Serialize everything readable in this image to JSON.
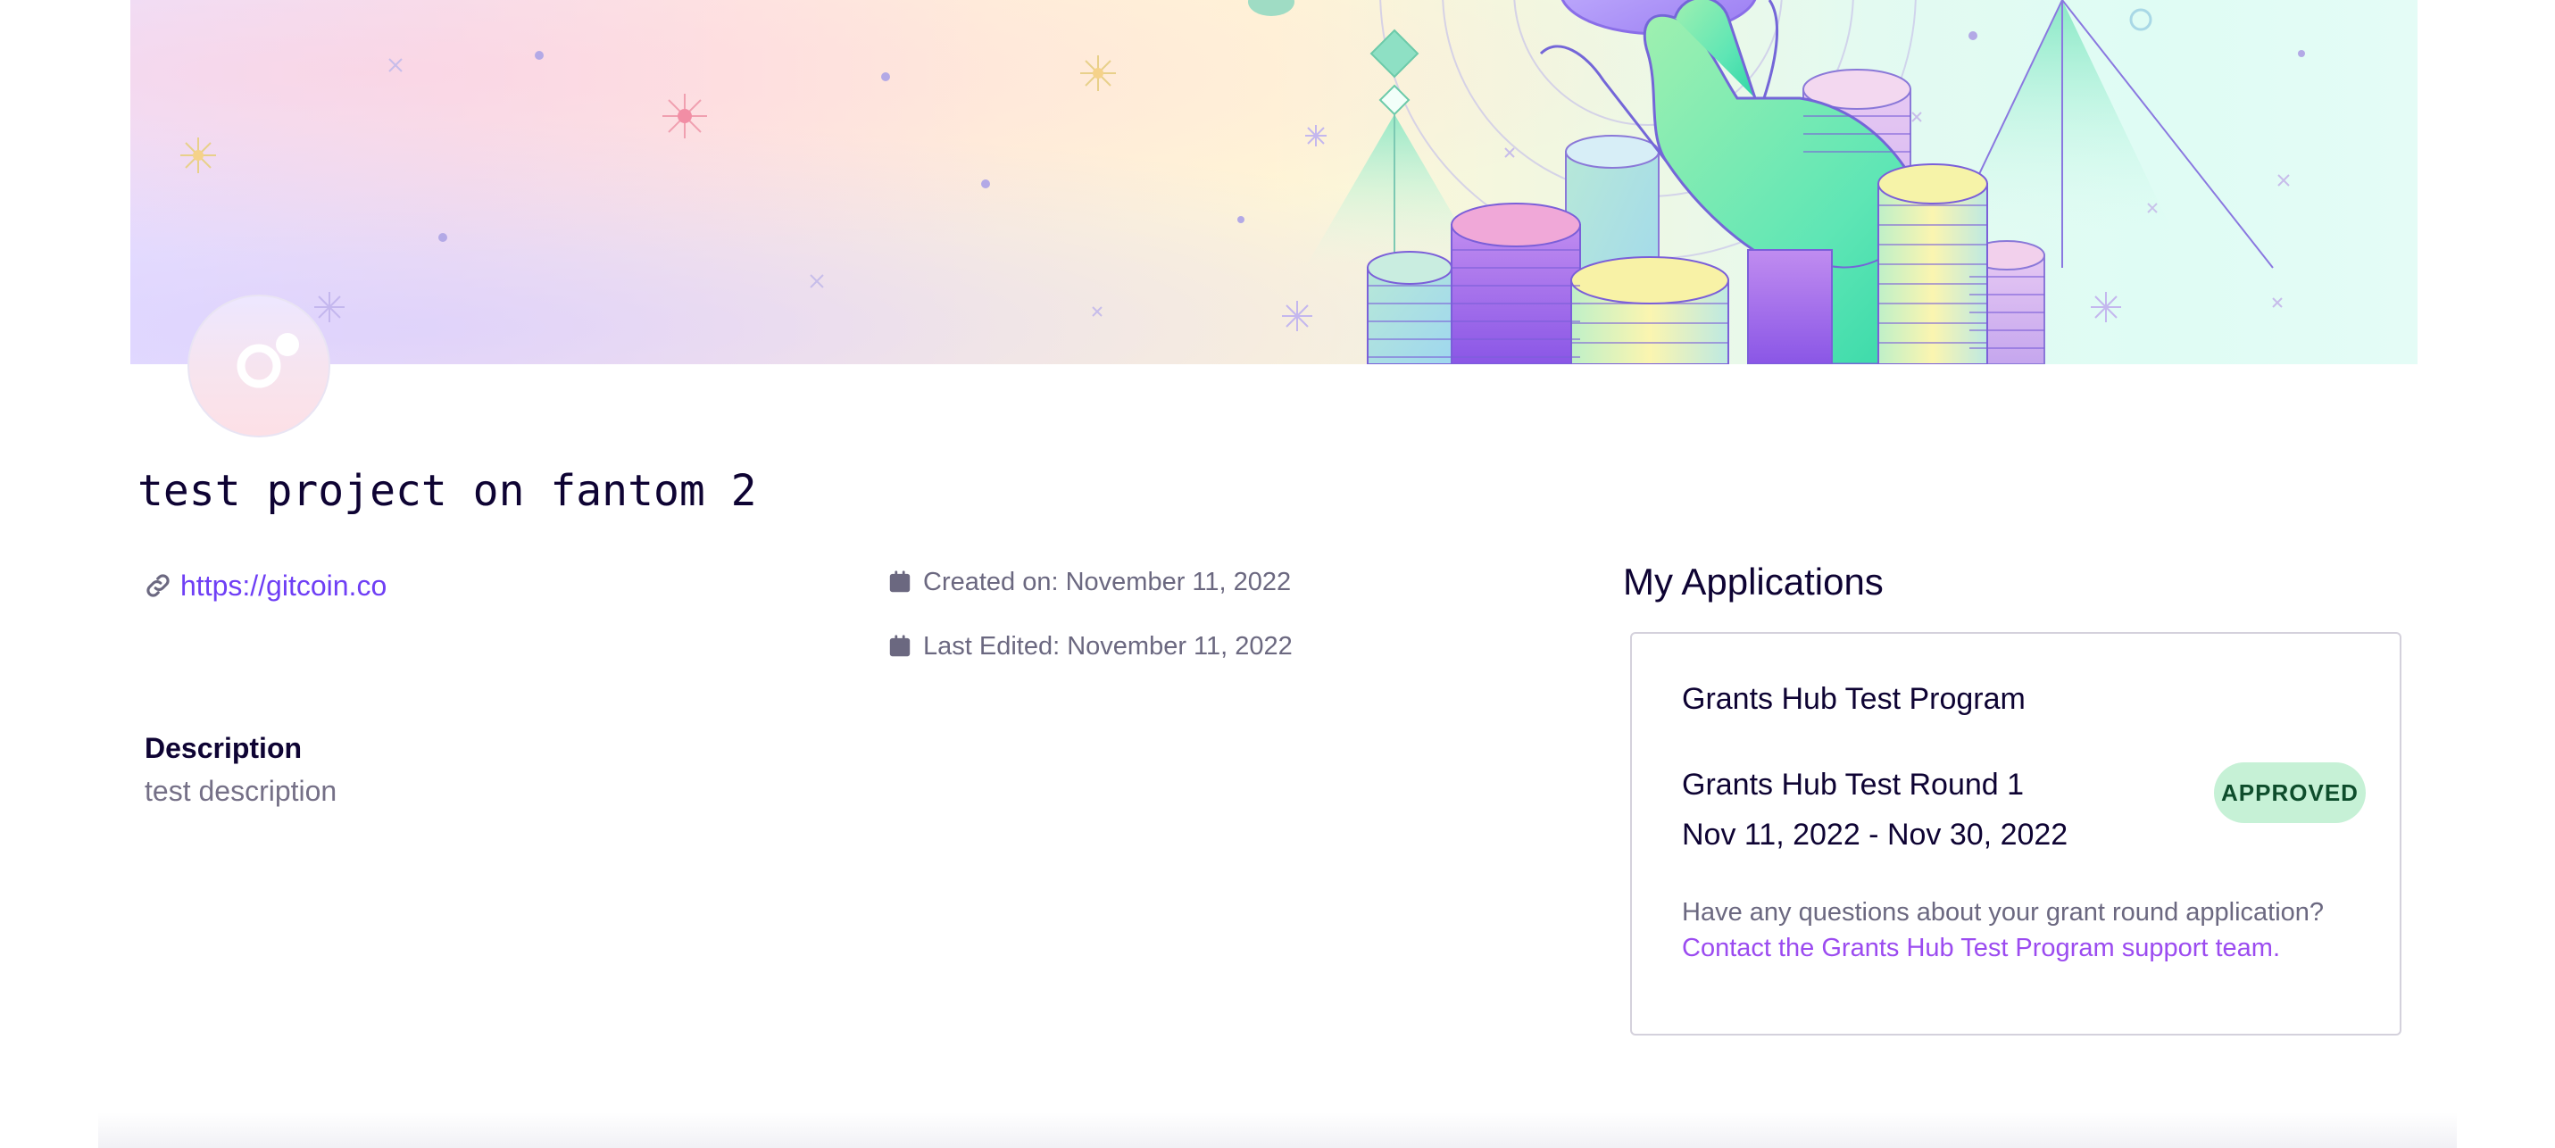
{
  "project": {
    "title": "test project on fantom 2",
    "website": "https://gitcoin.co",
    "created_on": "Created on: November 11, 2022",
    "last_edited": "Last Edited: November 11, 2022",
    "description_heading": "Description",
    "description": "test description"
  },
  "applications": {
    "heading": "My Applications",
    "items": [
      {
        "program_name": "Grants Hub Test Program",
        "round_name": "Grants Hub Test Round 1",
        "round_dates": "Nov 11, 2022 - Nov 30, 2022",
        "status": "APPROVED",
        "help_text": "Have any questions about your grant round application?",
        "support_link": "Contact the Grants Hub Test Program support team."
      }
    ]
  },
  "icons": {
    "website": "link-icon",
    "created": "calendar-icon",
    "edited": "calendar-icon"
  },
  "colors": {
    "link": "#6f3ff5",
    "support_link": "#9b4bf0",
    "badge_bg": "#c6f1d6",
    "badge_text": "#0e4d2c",
    "title": "#0e0333",
    "muted": "#6b6880"
  }
}
